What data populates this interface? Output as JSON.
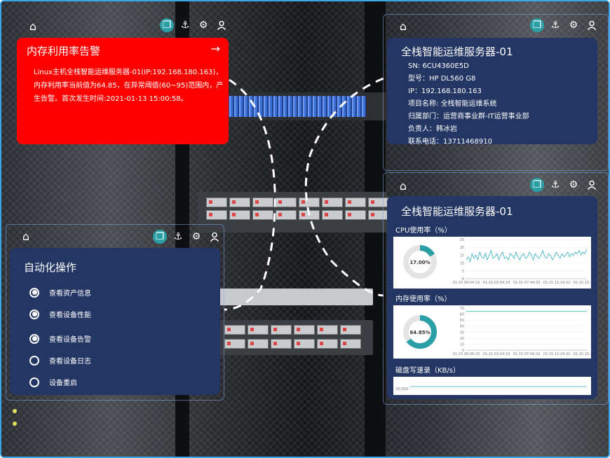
{
  "colors": {
    "panel": "#243663",
    "alert": "#ff0000",
    "accent": "#2aa0a6",
    "frame": "#3aa7e8",
    "line": "#2fb0bf"
  },
  "toolbar_icons": [
    "layers-icon",
    "anchor-icon",
    "gear-icon",
    "user-icon"
  ],
  "alert": {
    "title": "内存利用率告警",
    "text": "Linux主机全栈智能运维服务器-01(IP:192.168.180.163)，内存利用率当前值为64.85，在异常阈值(60~95)范围内，产生告警。首次发生时间:2021-01-13 15:00:58。"
  },
  "server_info": {
    "title": "全栈智能运维服务器-01",
    "fields": [
      {
        "label": "SN:",
        "value": "6CU4360E5D"
      },
      {
        "label": "型号：",
        "value": "HP DL560 G8"
      },
      {
        "label": "IP：",
        "value": "192.168.180.163"
      },
      {
        "label": "项目名称:",
        "value": "全栈智能运维系统"
      },
      {
        "label": "归属部门：",
        "value": "运营商事业群-IT运营事业部"
      },
      {
        "label": "负责人：",
        "value": "韩冰岩"
      },
      {
        "label": "联系电话：",
        "value": "13711468910"
      }
    ]
  },
  "automation": {
    "title": "自动化操作",
    "items": [
      {
        "label": "查看资产信息",
        "checked": true
      },
      {
        "label": "查看设备性能",
        "checked": true
      },
      {
        "label": "查看设备告警",
        "checked": true
      },
      {
        "label": "查看设备日志",
        "checked": false
      },
      {
        "label": "设备重启",
        "checked": false
      }
    ]
  },
  "performance": {
    "title": "全栈智能运维服务器-01",
    "cpu_label": "CPU使用率（%）",
    "mem_label": "内存使用率（%）",
    "disk_label": "磁盘写速录（KB/s）"
  },
  "chart_data": [
    {
      "type": "pie",
      "title": "",
      "values": [
        17.0,
        83.0
      ],
      "center_label": "17.00%"
    },
    {
      "type": "line",
      "title": "",
      "x": [
        "01-15 00:04:33",
        "01-15 03:54:33",
        "01-15 07:44:33",
        "01-15 11:24:32",
        "01-15 15:24:32"
      ],
      "ylim": [
        0,
        25
      ],
      "yticks": [
        0,
        5,
        10,
        15,
        20,
        25
      ],
      "series": [
        {
          "values": [
            12,
            14,
            11,
            16,
            13,
            15,
            12,
            17,
            14,
            13,
            16,
            12,
            15,
            18,
            13,
            14,
            16,
            12,
            15,
            17,
            13,
            14,
            12,
            16,
            15,
            13,
            17,
            14,
            12,
            15,
            16,
            13,
            14,
            17,
            15,
            12,
            16,
            14,
            13,
            15,
            18,
            14,
            13,
            16,
            15,
            12,
            14,
            17,
            15,
            13,
            16,
            14,
            15,
            17,
            14,
            16,
            15,
            17,
            16,
            18,
            15,
            17,
            16,
            19
          ]
        }
      ]
    },
    {
      "type": "pie",
      "title": "",
      "values": [
        64.85,
        35.15
      ],
      "center_label": "64.85%"
    },
    {
      "type": "line",
      "title": "",
      "x": [
        "01-15 00:04:33",
        "01-15 03:54:33",
        "01-15 07:44:33",
        "01-15 11:24:32",
        "01-15 15:24:32"
      ],
      "ylim": [
        0,
        70
      ],
      "yticks": [
        0,
        10,
        20,
        30,
        40,
        50,
        60,
        70
      ],
      "series": [
        {
          "values": [
            64.85,
            64.85,
            64.85,
            64.85,
            64.85,
            64.85,
            64.85,
            64.85,
            64.85,
            64.85
          ]
        }
      ]
    },
    {
      "type": "line",
      "title": "",
      "yticks": [
        "40,000",
        "50,000"
      ],
      "ylim": [
        40000,
        60000
      ],
      "series": [
        {
          "values": [
            52000,
            52000,
            52000,
            52000
          ]
        }
      ]
    }
  ]
}
